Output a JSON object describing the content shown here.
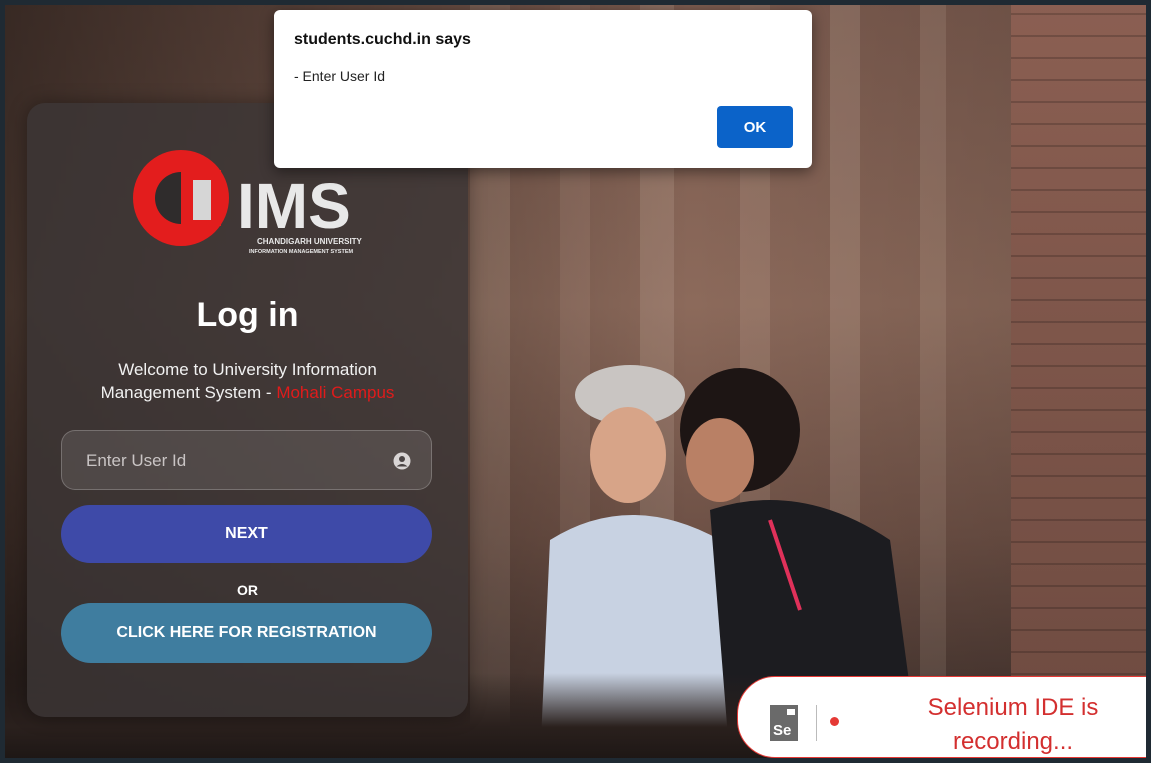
{
  "dialog": {
    "title": "students.cuchd.in says",
    "message": "- Enter User Id",
    "ok_label": "OK"
  },
  "login": {
    "logo_text": "IMS",
    "logo_mark": "CU",
    "logo_sub1": "CHANDIGARH UNIVERSITY",
    "logo_sub2": "INFORMATION MANAGEMENT SYSTEM",
    "title": "Log in",
    "welcome_line1": "Welcome to University Information",
    "welcome_line2": "Management System - ",
    "campus": "Mohali Campus",
    "userid_placeholder": "Enter User Id",
    "next_label": "NEXT",
    "or_label": "OR",
    "register_label": "CLICK HERE FOR REGISTRATION"
  },
  "selenium": {
    "logo_text": "Se",
    "status_text": "Selenium IDE is recording..."
  },
  "colors": {
    "next_button": "#3e4aa8",
    "register_button": "#3f7d9f",
    "campus_text": "#e01b1b",
    "dialog_ok": "#0b63c9",
    "selenium_red": "#d32f2f"
  }
}
